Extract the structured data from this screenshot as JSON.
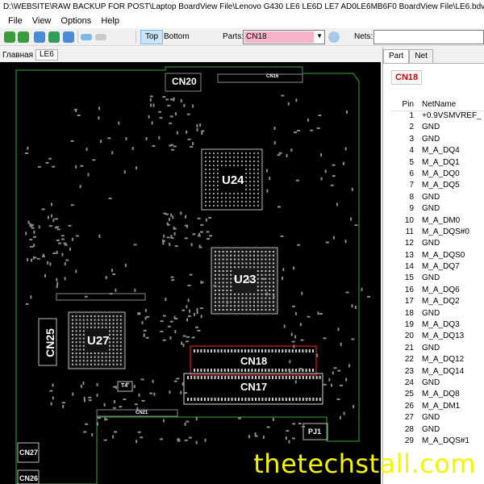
{
  "window": {
    "title": "D:\\WEBSITE\\RAW BACKUP FOR POST\\Laptop BoardView File\\Lenovo G430 LE6 LE6D LE7 AD0LE6MB6F0 BoardView File\\LE6.bdv"
  },
  "menu": [
    "File",
    "View",
    "Options",
    "Help"
  ],
  "toolbar": {
    "top_label": "Top",
    "bottom_label": "Bottom",
    "parts_label": "Parts:",
    "parts_value": "CN18",
    "nets_label": "Nets:",
    "nets_value": ""
  },
  "board": {
    "caption": "Главная",
    "name": "LE6"
  },
  "parts": {
    "cn20": "CN20",
    "cn16": "CN16",
    "u24": "U24",
    "u23": "U23",
    "u27": "U27",
    "cn25": "CN25",
    "cn18": "CN18",
    "cn17": "CN17",
    "cn21": "CN21",
    "cn27": "CN27",
    "cn26": "CN26",
    "pj1": "PJ1",
    "t4": "T4"
  },
  "panel": {
    "tab_part": "Part",
    "tab_net": "Net",
    "selected_part": "CN18",
    "col_pin": "Pin",
    "col_net": "NetName",
    "pins": [
      {
        "pin": "1",
        "net": "+0.9VSMVREF_"
      },
      {
        "pin": "2",
        "net": "GND"
      },
      {
        "pin": "3",
        "net": "GND"
      },
      {
        "pin": "4",
        "net": "M_A_DQ4"
      },
      {
        "pin": "5",
        "net": "M_A_DQ1"
      },
      {
        "pin": "6",
        "net": "M_A_DQ0"
      },
      {
        "pin": "7",
        "net": "M_A_DQ5"
      },
      {
        "pin": "8",
        "net": "GND"
      },
      {
        "pin": "9",
        "net": "GND"
      },
      {
        "pin": "10",
        "net": "M_A_DM0"
      },
      {
        "pin": "11",
        "net": "M_A_DQS#0"
      },
      {
        "pin": "12",
        "net": "GND"
      },
      {
        "pin": "13",
        "net": "M_A_DQS0"
      },
      {
        "pin": "14",
        "net": "M_A_DQ7"
      },
      {
        "pin": "15",
        "net": "GND"
      },
      {
        "pin": "16",
        "net": "M_A_DQ6"
      },
      {
        "pin": "17",
        "net": "M_A_DQ2"
      },
      {
        "pin": "18",
        "net": "GND"
      },
      {
        "pin": "19",
        "net": "M_A_DQ3"
      },
      {
        "pin": "20",
        "net": "M_A_DQ13"
      },
      {
        "pin": "21",
        "net": "GND"
      },
      {
        "pin": "22",
        "net": "M_A_DQ12"
      },
      {
        "pin": "23",
        "net": "M_A_DQ14"
      },
      {
        "pin": "24",
        "net": "GND"
      },
      {
        "pin": "25",
        "net": "M_A_DQ8"
      },
      {
        "pin": "26",
        "net": "M_A_DM1"
      },
      {
        "pin": "27",
        "net": "GND"
      },
      {
        "pin": "28",
        "net": "GND"
      },
      {
        "pin": "29",
        "net": "M_A_DQS#1"
      }
    ]
  },
  "watermark": "thetechstall.com"
}
